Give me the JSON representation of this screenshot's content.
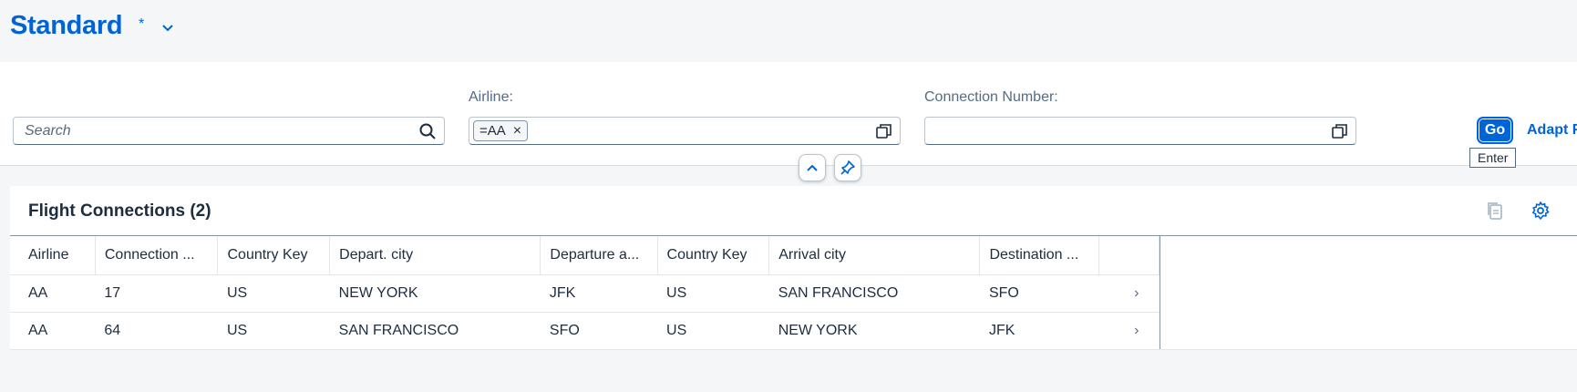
{
  "header": {
    "variant_title": "Standard",
    "variant_modified": "*"
  },
  "filterbar": {
    "search": {
      "placeholder": "Search",
      "value": ""
    },
    "airline": {
      "label": "Airline:",
      "token": "=AA",
      "token_remove": "×"
    },
    "connection": {
      "label": "Connection Number:",
      "value": ""
    },
    "go_label": "Go",
    "adapt_label": "Adapt F",
    "go_tooltip": "Enter"
  },
  "table": {
    "title": "Flight Connections (2)",
    "columns": [
      "Airline",
      "Connection ...",
      "Country Key",
      "Depart. city",
      "Departure a...",
      "Country Key",
      "Arrival city",
      "Destination ...",
      ""
    ],
    "rows": [
      [
        "AA",
        "17",
        "US",
        "NEW YORK",
        "JFK",
        "US",
        "SAN FRANCISCO",
        "SFO",
        "›"
      ],
      [
        "AA",
        "64",
        "US",
        "SAN FRANCISCO",
        "SFO",
        "US",
        "NEW YORK",
        "JFK",
        "›"
      ]
    ]
  },
  "colors": {
    "accent": "#0064d9",
    "text": "#1d2d3e",
    "label": "#556b82",
    "background": "#f5f6f7"
  },
  "icons": [
    "chevron-down-icon",
    "search-icon",
    "value-help-icon",
    "collapse-icon",
    "pin-icon",
    "copy-icon",
    "settings-icon",
    "navigation-arrow-icon"
  ]
}
